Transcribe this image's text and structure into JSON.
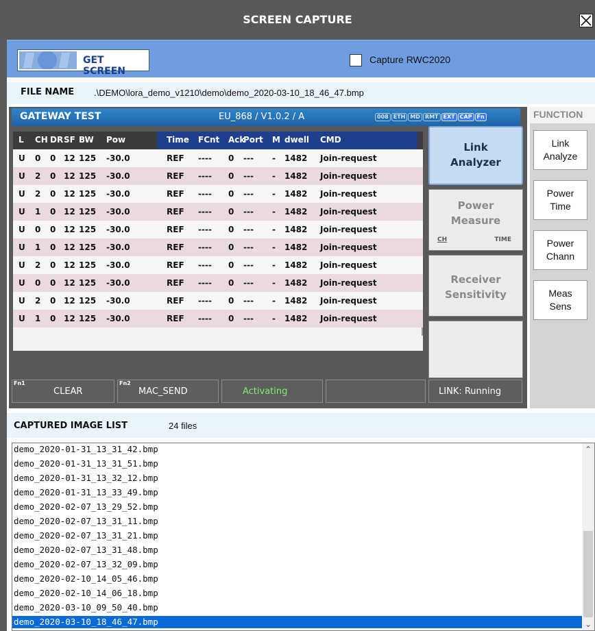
{
  "window": {
    "title": "SCREEN CAPTURE"
  },
  "toolbar": {
    "get_screen_label": "GET SCREEN",
    "capture_rwc_label": "Capture RWC2020",
    "capture_rwc_checked": false
  },
  "file": {
    "label": "FILE NAME",
    "value": ".\\DEMO\\lora_demo_v1210\\demo\\demo_2020-03-10_18_46_47.bmp"
  },
  "gateway": {
    "title": "GATEWAY TEST",
    "band": "EU_868 / V1.0.2 / A",
    "badges": [
      {
        "text": "008",
        "on": false
      },
      {
        "text": "ETH",
        "on": false
      },
      {
        "text": "MD",
        "on": false
      },
      {
        "text": "RMT",
        "on": false
      },
      {
        "text": "EXT",
        "on": true
      },
      {
        "text": "CAP",
        "on": true
      },
      {
        "text": "Fn",
        "on": true
      }
    ],
    "columns": [
      "L",
      "CH",
      "DR",
      "SF",
      "BW",
      "Pow",
      "Time",
      "FCnt",
      "Ack",
      "Port",
      "M",
      "dwell",
      "CMD"
    ],
    "rows": [
      [
        "U",
        "0",
        "0",
        "12",
        "125",
        "-30.0",
        "REF",
        "----",
        "0",
        "---",
        "-",
        "1482",
        "Join-request"
      ],
      [
        "U",
        "2",
        "0",
        "12",
        "125",
        "-30.0",
        "REF",
        "----",
        "0",
        "---",
        "-",
        "1482",
        "Join-request"
      ],
      [
        "U",
        "2",
        "0",
        "12",
        "125",
        "-30.0",
        "REF",
        "----",
        "0",
        "---",
        "-",
        "1482",
        "Join-request"
      ],
      [
        "U",
        "1",
        "0",
        "12",
        "125",
        "-30.0",
        "REF",
        "----",
        "0",
        "---",
        "-",
        "1482",
        "Join-request"
      ],
      [
        "U",
        "0",
        "0",
        "12",
        "125",
        "-30.0",
        "REF",
        "----",
        "0",
        "---",
        "-",
        "1482",
        "Join-request"
      ],
      [
        "U",
        "1",
        "0",
        "12",
        "125",
        "-30.0",
        "REF",
        "----",
        "0",
        "---",
        "-",
        "1482",
        "Join-request"
      ],
      [
        "U",
        "2",
        "0",
        "12",
        "125",
        "-30.0",
        "REF",
        "----",
        "0",
        "---",
        "-",
        "1482",
        "Join-request"
      ],
      [
        "U",
        "0",
        "0",
        "12",
        "125",
        "-30.0",
        "REF",
        "----",
        "0",
        "---",
        "-",
        "1482",
        "Join-request"
      ],
      [
        "U",
        "2",
        "0",
        "12",
        "125",
        "-30.0",
        "REF",
        "----",
        "0",
        "---",
        "-",
        "1482",
        "Join-request"
      ],
      [
        "U",
        "1",
        "0",
        "12",
        "125",
        "-30.0",
        "REF",
        "----",
        "0",
        "---",
        "-",
        "1482",
        "Join-request"
      ]
    ],
    "side_buttons": {
      "link": {
        "line1": "Link",
        "line2": "Analyzer"
      },
      "power": {
        "line1": "Power",
        "line2": "Measure",
        "sub_left": "CH",
        "sub_right": "TIME"
      },
      "receiver": {
        "line1": "Receiver",
        "line2": "Sensitivity"
      }
    },
    "fn_bar": {
      "clear": {
        "fn": "Fn1",
        "label": "CLEAR"
      },
      "mac_send": {
        "fn": "Fn2",
        "label": "MAC_SEND"
      },
      "status": "Activating",
      "link_status": "LINK: Running"
    }
  },
  "function_panel": {
    "header": "FUNCTION",
    "buttons": [
      {
        "line1": "Link",
        "line2": "Analyze"
      },
      {
        "line1": "Power",
        "line2": "Time"
      },
      {
        "line1": "Power",
        "line2": "Chann"
      },
      {
        "line1": "Meas",
        "line2": "Sens"
      }
    ]
  },
  "captured": {
    "label": "CAPTURED IMAGE LIST",
    "count": "24 files",
    "files": [
      "demo_2020-01-31_13_31_42.bmp",
      "demo_2020-01-31_13_31_51.bmp",
      "demo_2020-01-31_13_32_12.bmp",
      "demo_2020-01-31_13_33_49.bmp",
      "demo_2020-02-07_13_29_52.bmp",
      "demo_2020-02-07_13_31_11.bmp",
      "demo_2020-02-07_13_31_21.bmp",
      "demo_2020-02-07_13_31_48.bmp",
      "demo_2020-02-07_13_32_09.bmp",
      "demo_2020-02-10_14_05_46.bmp",
      "demo_2020-02-10_14_06_18.bmp",
      "demo_2020-03-10_09_50_40.bmp",
      "demo_2020-03-10_18_46_47.bmp"
    ],
    "selected_index": 12
  },
  "colors": {
    "accent": "#6f9ddf",
    "selection": "#0a6ad6",
    "activating": "#7cf06a"
  }
}
